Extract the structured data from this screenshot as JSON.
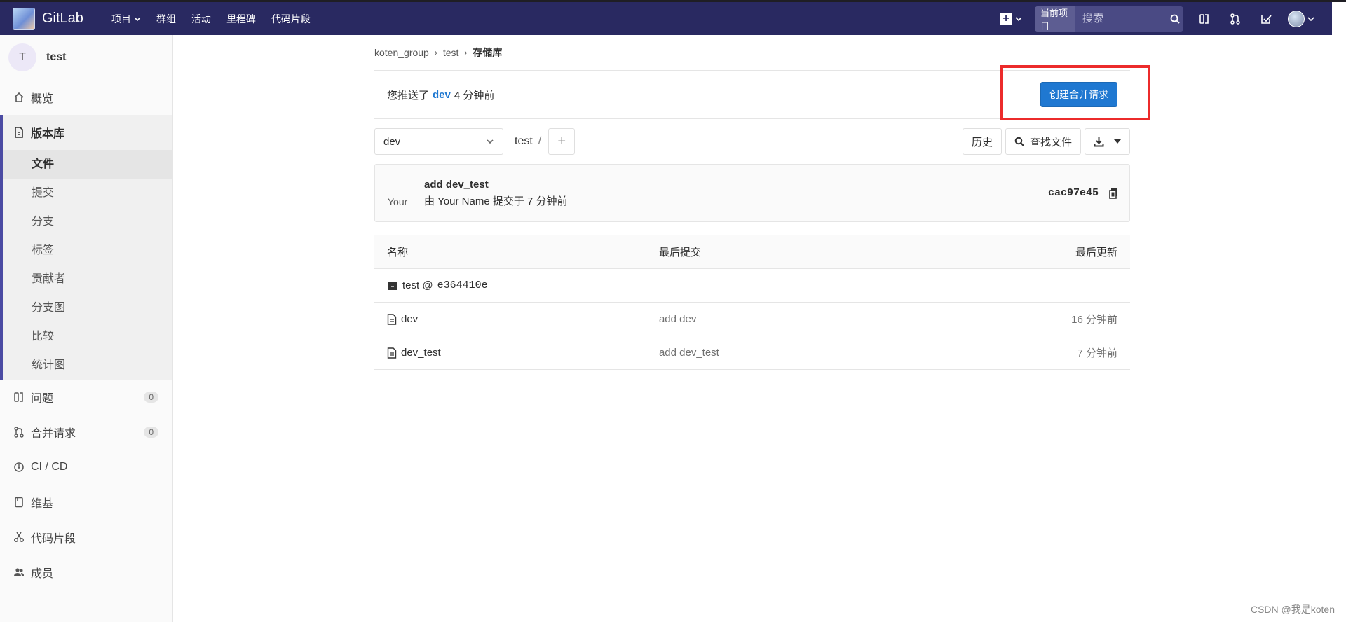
{
  "navbar": {
    "brand": "GitLab",
    "links": [
      "项目",
      "群组",
      "活动",
      "里程碑",
      "代码片段"
    ],
    "search": {
      "scope": "当前项目",
      "placeholder": "搜索"
    }
  },
  "sidebar": {
    "project_initial": "T",
    "project_name": "test",
    "overview": "概览",
    "repository": "版本库",
    "repo_subitems": [
      "文件",
      "提交",
      "分支",
      "标签",
      "贡献者",
      "分支图",
      "比较",
      "统计图"
    ],
    "issues": {
      "label": "问题",
      "count": "0"
    },
    "merge_requests": {
      "label": "合并请求",
      "count": "0"
    },
    "cicd": "CI / CD",
    "wiki": "维基",
    "snippets": "代码片段",
    "members": "成员"
  },
  "breadcrumb": [
    "koten_group",
    "test",
    "存储库"
  ],
  "push_notice": {
    "prefix": "您推送了",
    "branch": "dev",
    "suffix": "4 分钟前",
    "button": "创建合并请求"
  },
  "tree": {
    "branch": "dev",
    "path": "test",
    "path_sep": "/",
    "history_label": "历史",
    "find_file_label": "查找文件"
  },
  "last_commit": {
    "avatar_alt": "Your",
    "title": "add dev_test",
    "meta": "由 Your Name 提交于 7 分钟前",
    "sha": "cac97e45"
  },
  "files": {
    "headers": [
      "名称",
      "最后提交",
      "最后更新"
    ],
    "submodule": {
      "name": "test @",
      "hash": "e364410e"
    },
    "rows": [
      {
        "name": "dev",
        "message": "add dev",
        "updated": "16 分钟前"
      },
      {
        "name": "dev_test",
        "message": "add dev_test",
        "updated": "7 分钟前"
      }
    ]
  },
  "watermark": "CSDN @我是koten",
  "colors": {
    "navbar": "#292961",
    "primary": "#1f78d1",
    "highlight": "#ec2b2b"
  }
}
